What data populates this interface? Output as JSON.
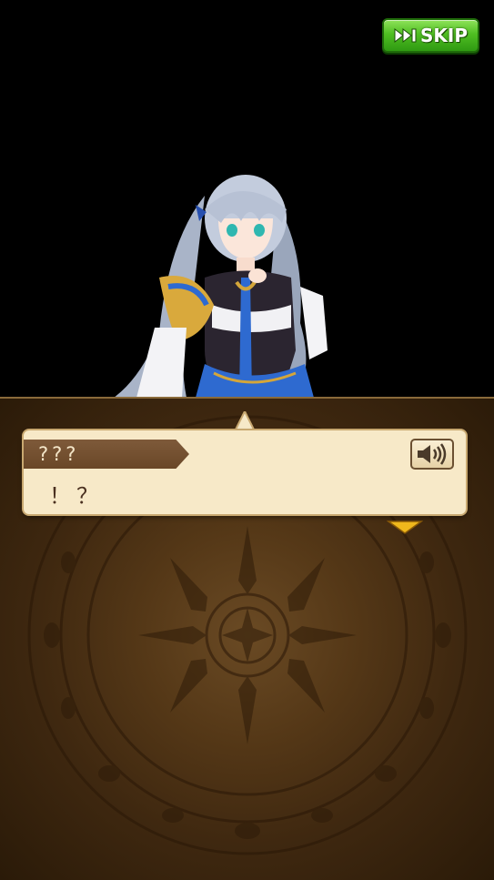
{
  "skip_button": {
    "label": "SKIP",
    "icon": "fast-forward-icon",
    "color": "#4fbe22"
  },
  "dialog": {
    "speaker": "???",
    "text": "！？",
    "voice_icon": "speaker-icon",
    "advance_icon": "triangle-down-icon"
  },
  "colors": {
    "dialog_bg": "#f7e9c8",
    "name_plate": "#6a4727",
    "panel_bg": "#553817",
    "arrow": "#f0b81c"
  }
}
